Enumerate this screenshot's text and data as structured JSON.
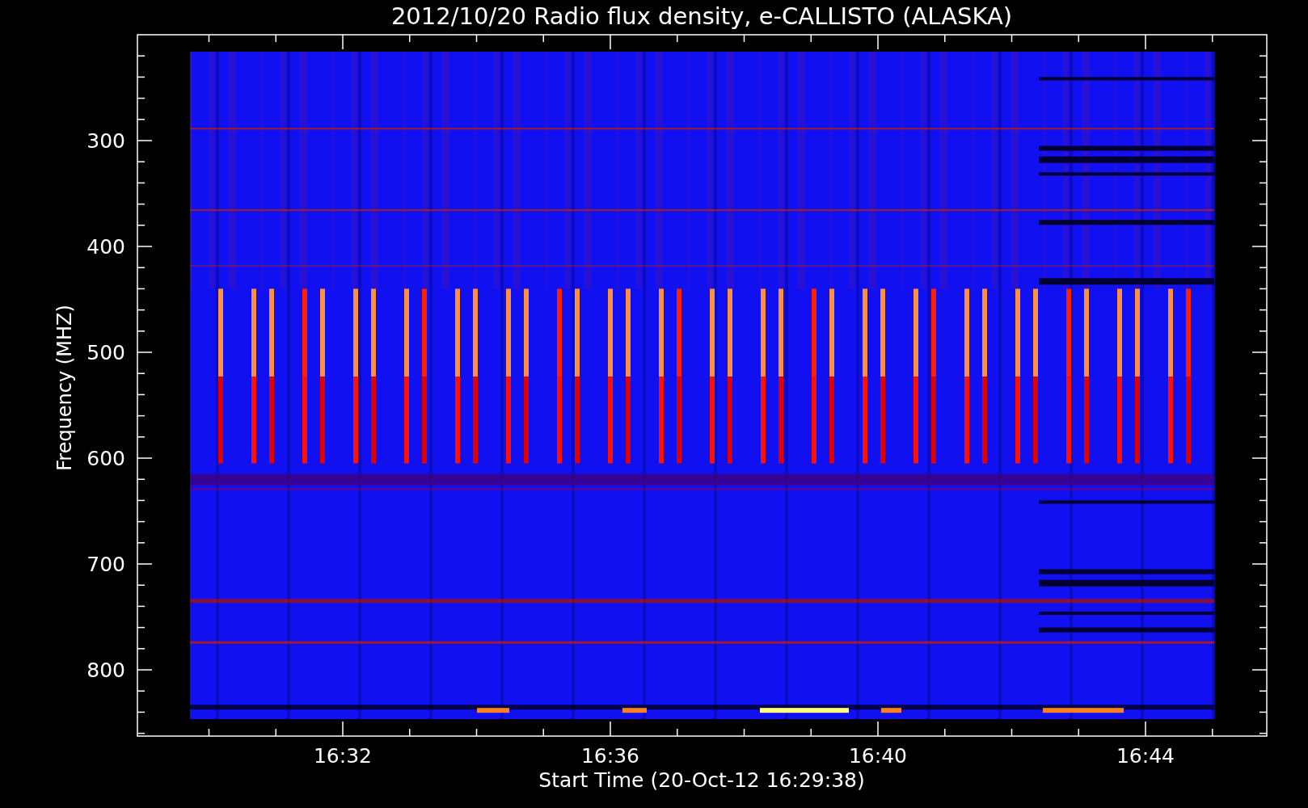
{
  "title": "2012/10/20  Radio flux density, e-CALLISTO (ALASKA)",
  "ylabel": "Frequency (MHZ)",
  "xlabel": "Start Time (20-Oct-12 16:29:38)",
  "yticks": [
    "300",
    "400",
    "500",
    "600",
    "700",
    "800"
  ],
  "xticks": [
    "16:32",
    "16:36",
    "16:40",
    "16:44"
  ]
}
